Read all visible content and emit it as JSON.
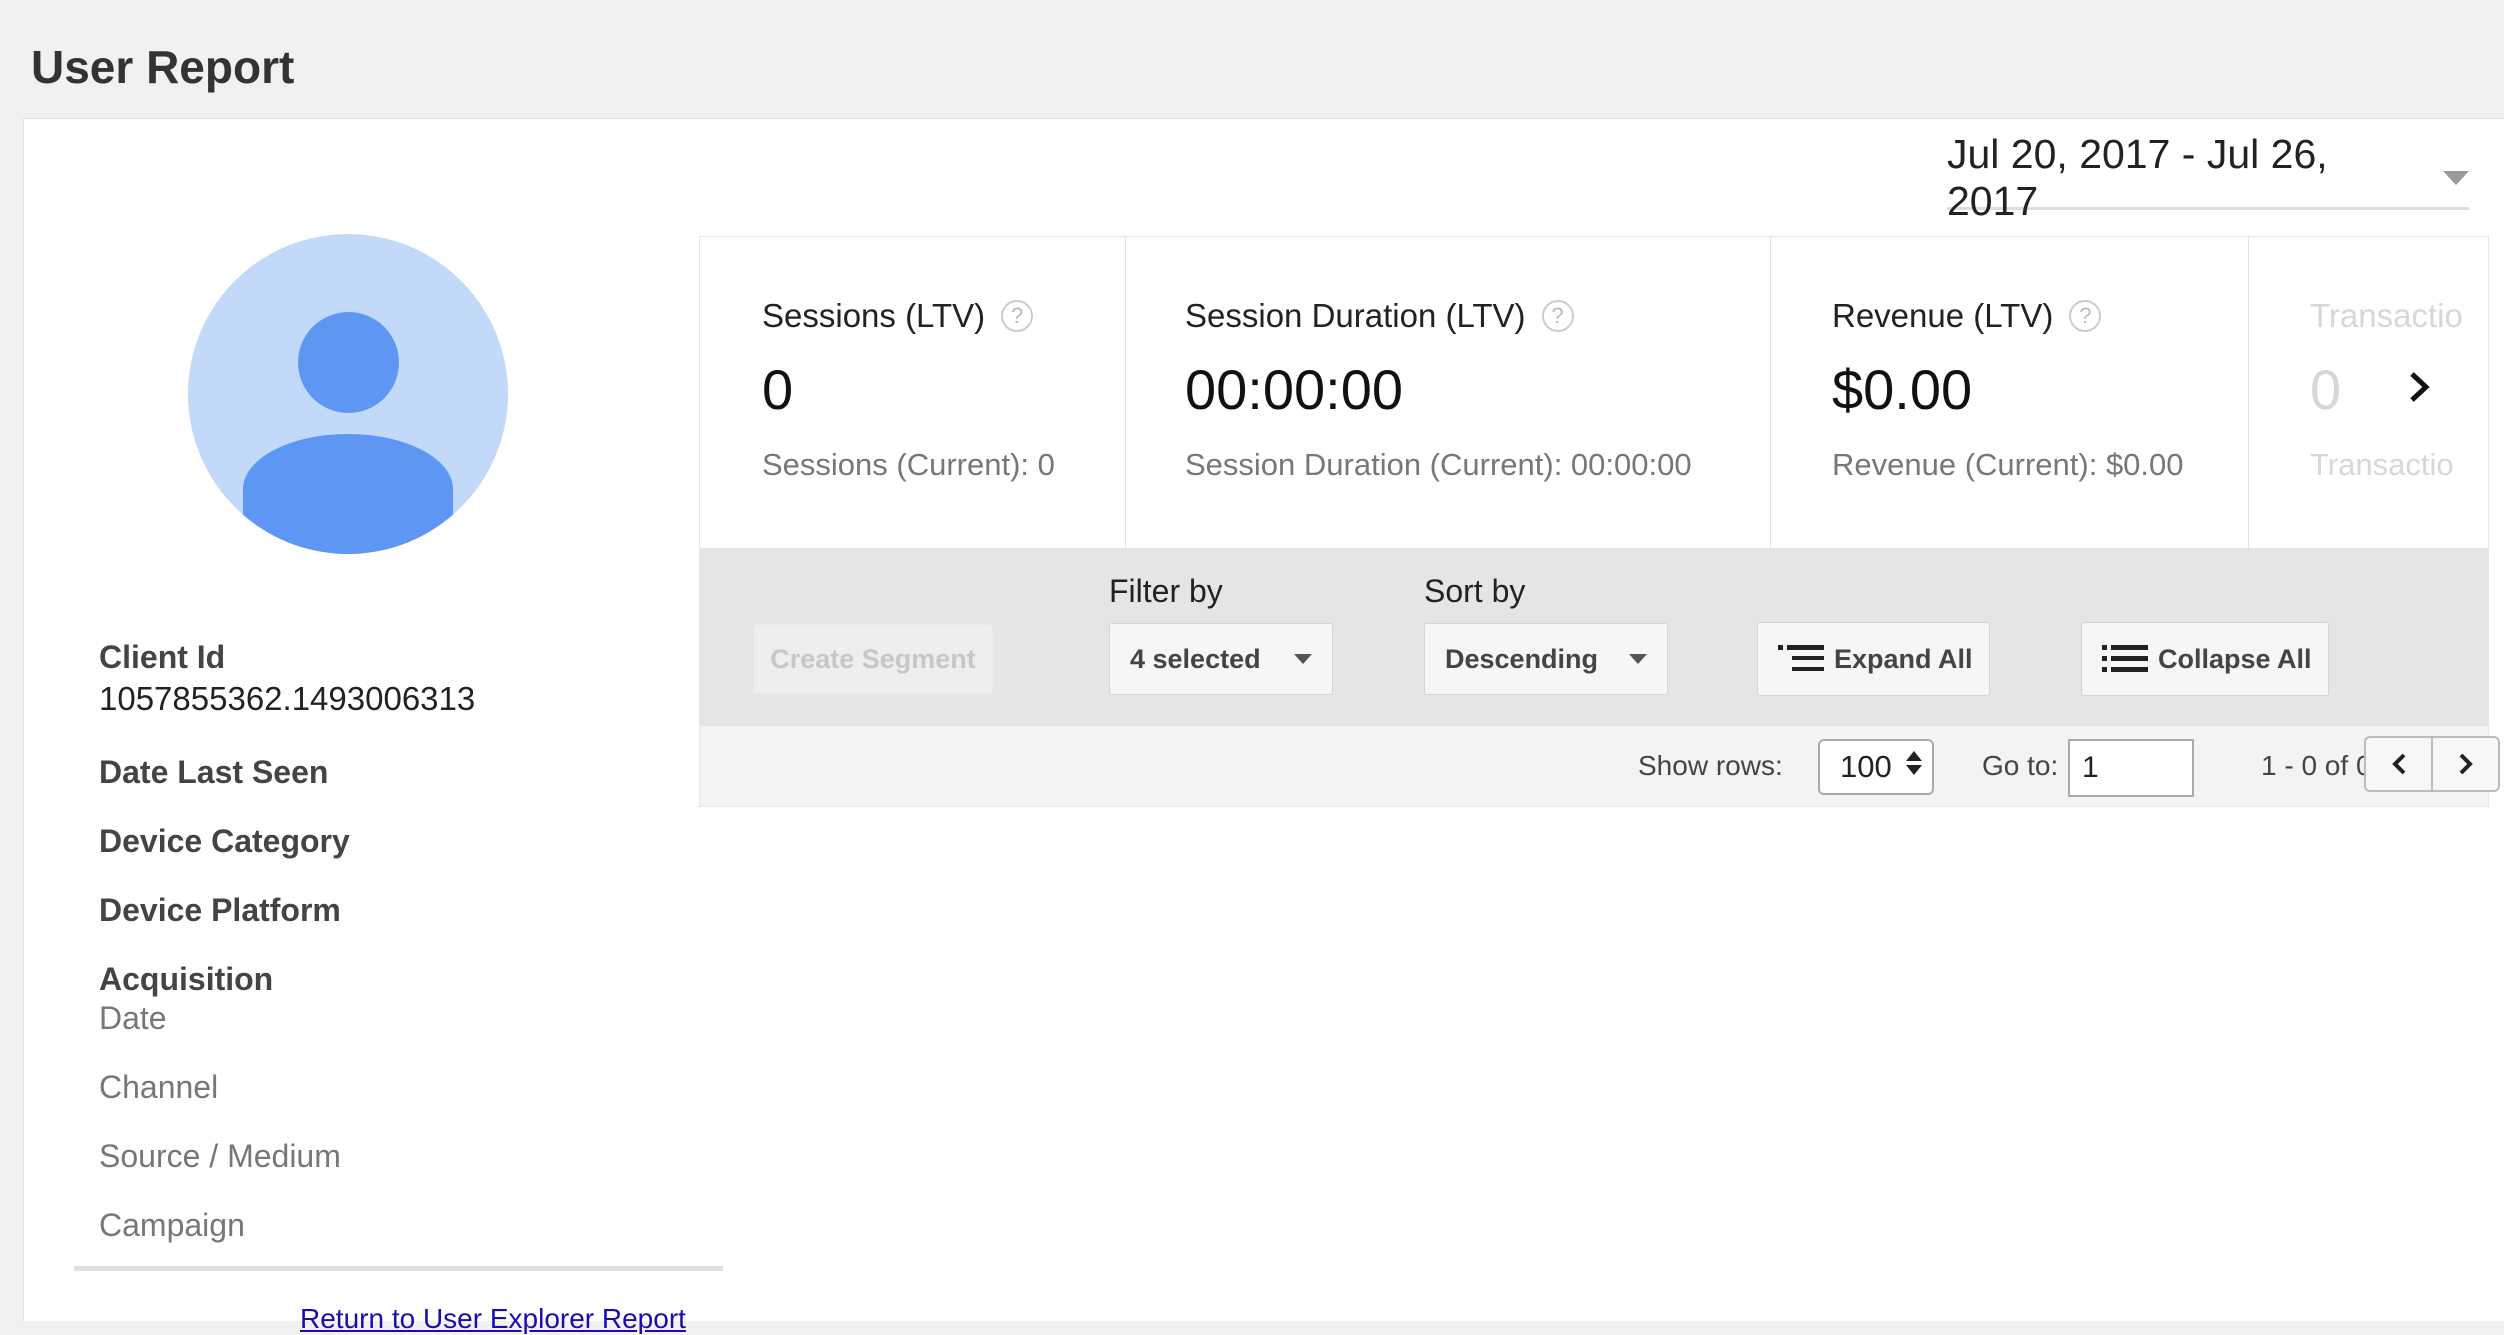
{
  "page": {
    "title": "User Report"
  },
  "date_range": {
    "label": "Jul 20, 2017 - Jul 26, 2017"
  },
  "user": {
    "client_id_label": "Client Id",
    "client_id": "1057855362.1493006313",
    "date_last_seen_label": "Date Last Seen",
    "device_category_label": "Device Category",
    "device_platform_label": "Device Platform",
    "acquisition_label": "Acquisition",
    "acquisition_items": [
      "Date",
      "Channel",
      "Source / Medium",
      "Campaign"
    ]
  },
  "return_link": "Return to User Explorer Report",
  "metrics": [
    {
      "label": "Sessions (LTV)",
      "value": "0",
      "current": "Sessions (Current): 0"
    },
    {
      "label": "Session Duration (LTV)",
      "value": "00:00:00",
      "current": "Session Duration (Current): 00:00:00"
    },
    {
      "label": "Revenue (LTV)",
      "value": "$0.00",
      "current": "Revenue (Current): $0.00"
    },
    {
      "label": "Transactio",
      "value": "0",
      "current": "Transactio"
    }
  ],
  "help_glyph": "?",
  "toolbar": {
    "create_segment": "Create Segment",
    "filter_label": "Filter by",
    "filter_value": "4 selected",
    "sort_label": "Sort by",
    "sort_value": "Descending",
    "expand_all": "Expand All",
    "collapse_all": "Collapse All"
  },
  "pagination": {
    "show_rows_label": "Show rows:",
    "show_rows_value": "100",
    "goto_label": "Go to:",
    "goto_value": "1",
    "range_text": "1 - 0 of 0"
  },
  "colors": {
    "avatar_bg": "#c2d9fa",
    "avatar_fg": "#5e97f3",
    "link": "#1a0dab"
  },
  "icons": [
    "caret-down-icon",
    "help-icon",
    "chevron-right-icon",
    "chevron-left-icon",
    "expand-list-icon",
    "collapse-list-icon",
    "spinner-arrows-icon"
  ]
}
